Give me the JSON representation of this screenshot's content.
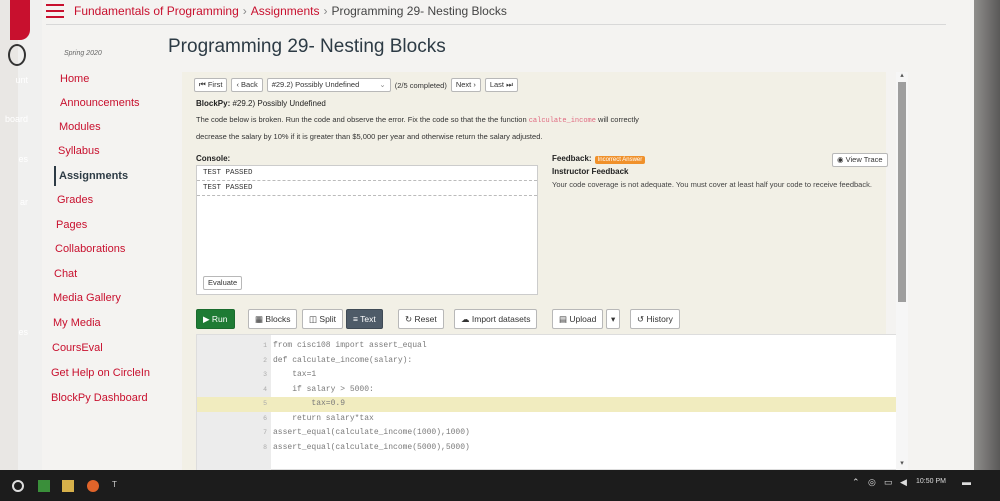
{
  "breadcrumb": {
    "items": [
      "Fundamentals of Programming",
      "Assignments",
      "Programming 29- Nesting Blocks"
    ]
  },
  "page_title": "Programming 29- Nesting Blocks",
  "global_nav": {
    "labels": [
      "unt",
      "board",
      "es",
      "ar",
      "es"
    ]
  },
  "term": "Spring 2020",
  "course_nav": {
    "items": [
      {
        "label": "Home"
      },
      {
        "label": "Announcements"
      },
      {
        "label": "Modules"
      },
      {
        "label": "Syllabus"
      },
      {
        "label": "Assignments",
        "active": true
      },
      {
        "label": "Grades"
      },
      {
        "label": "Pages"
      },
      {
        "label": "Collaborations"
      },
      {
        "label": "Chat"
      },
      {
        "label": "Media Gallery"
      },
      {
        "label": "My Media"
      },
      {
        "label": "CoursEval"
      },
      {
        "label": "Get Help on CircleIn"
      },
      {
        "label": "BlockPy Dashboard"
      }
    ]
  },
  "problem_nav": {
    "first": "First",
    "back": "Back",
    "selected_problem": "#29.2) Possibly Undefined",
    "completed": "(2/5 completed)",
    "next": "Next",
    "last": "Last"
  },
  "task": {
    "prefix": "BlockPy:",
    "title": "#29.2) Possibly Undefined",
    "desc_part1": "The code below is broken. Run the code and observe the error. Fix the code so that the the function",
    "desc_code": "calculate_income",
    "desc_part2": "will correctly",
    "desc_line2": "decrease the salary by 10% if it is greater than $5,000 per year and otherwise return the salary adjusted."
  },
  "console": {
    "label": "Console:",
    "lines": [
      "TEST PASSED",
      "TEST PASSED"
    ],
    "evaluate_label": "Evaluate"
  },
  "feedback": {
    "label": "Feedback:",
    "badge": "Incorrect Answer",
    "view_trace": "View Trace",
    "instructor_title": "Instructor Feedback",
    "instructor_text": "Your code coverage is not adequate. You must cover at least half your code to receive feedback."
  },
  "toolbar": {
    "run": "Run",
    "blocks": "Blocks",
    "split": "Split",
    "text": "Text",
    "reset": "Reset",
    "import": "Import datasets",
    "upload": "Upload",
    "history": "History"
  },
  "code": {
    "lines": [
      "from cisc108 import assert_equal",
      "def calculate_income(salary):",
      "    tax=1",
      "    if salary > 5000:",
      "        tax=0.9",
      "    return salary*tax",
      "assert_equal(calculate_income(1000),1000)",
      "assert_equal(calculate_income(5000),5000)"
    ],
    "highlighted_line": 5
  },
  "taskbar": {
    "time": "10:50 PM"
  },
  "colors": {
    "brand": "#c8102e",
    "run_button": "#1e7b34",
    "active_toggle": "#4e5b68",
    "badge": "#f0912b",
    "highlight_line": "#f1ecbf"
  }
}
